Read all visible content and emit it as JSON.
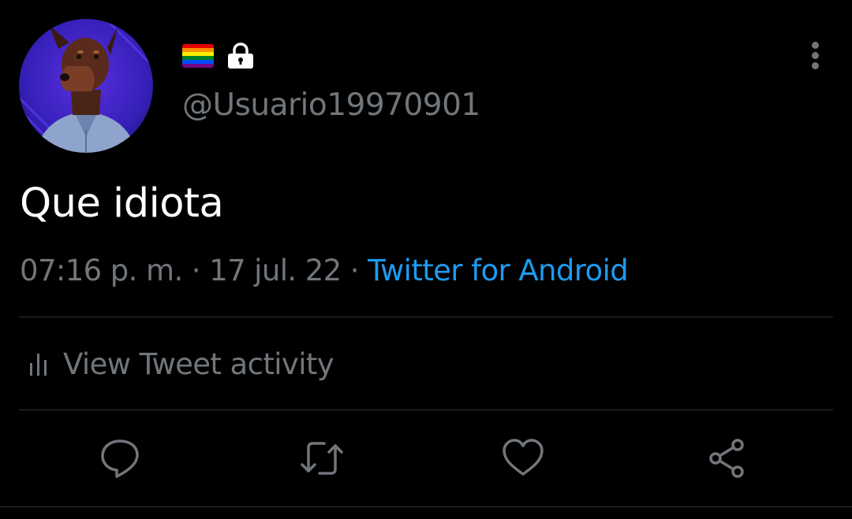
{
  "tweet": {
    "handle": "@Usuario19970901",
    "text": "Que idiota",
    "time": "07:16 p. m.",
    "separator": "·",
    "date": "17 jul. 22",
    "source": "Twitter for Android"
  },
  "profile": {
    "avatar_icon": "doberman-avatar",
    "badges": [
      "rainbow-flag-icon",
      "lock-icon"
    ]
  },
  "activity": {
    "label": "View Tweet activity",
    "icon": "bar-chart-icon"
  },
  "actions": [
    {
      "name": "reply",
      "icon": "reply-icon"
    },
    {
      "name": "retweet",
      "icon": "retweet-icon"
    },
    {
      "name": "like",
      "icon": "heart-icon"
    },
    {
      "name": "share",
      "icon": "share-icon"
    }
  ],
  "colors": {
    "background": "#000000",
    "text": "#ffffff",
    "secondary": "#71767b",
    "link": "#1d9bf0",
    "divider": "#2f3336"
  }
}
